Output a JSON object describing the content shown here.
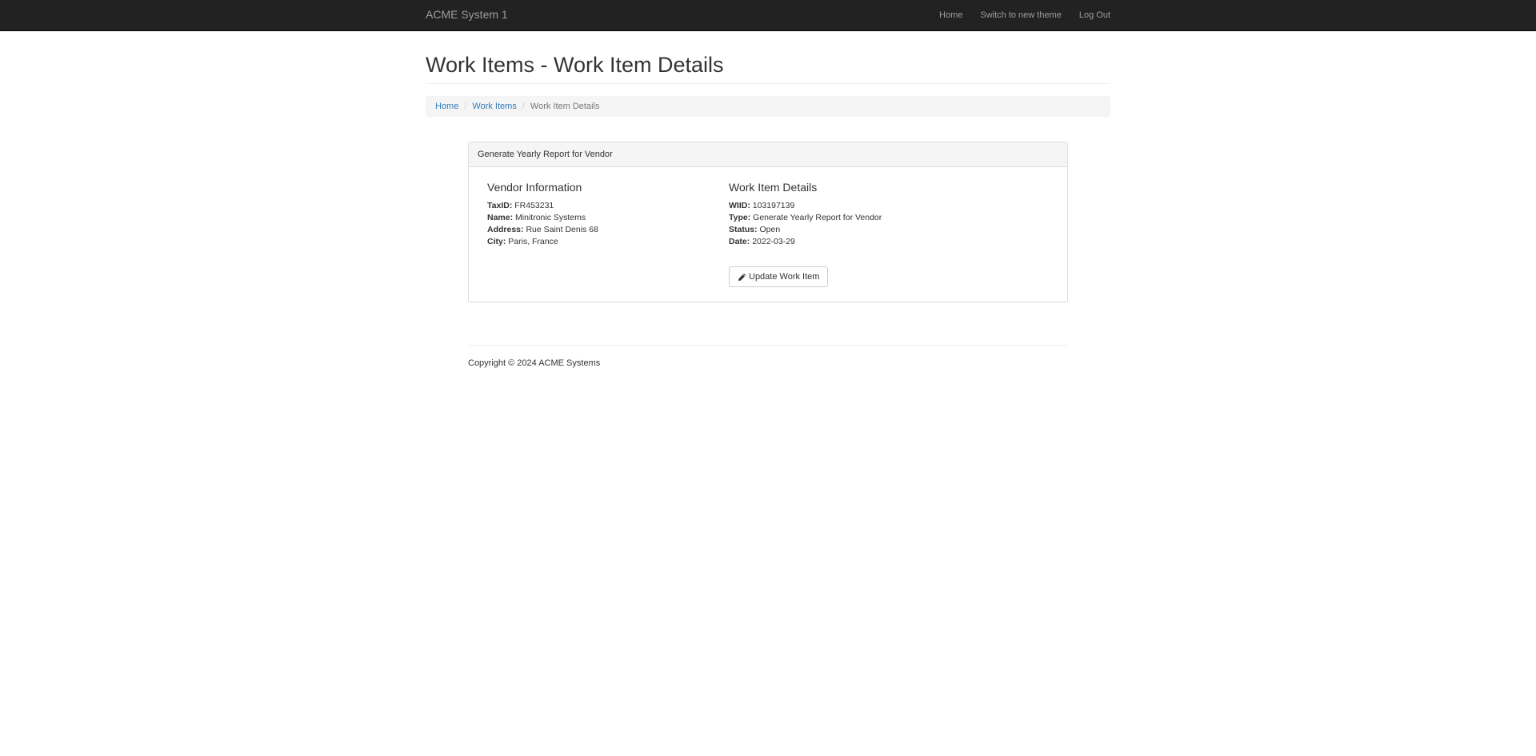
{
  "navbar": {
    "brand": "ACME System 1",
    "links": [
      "Home",
      "Switch to new theme",
      "Log Out"
    ]
  },
  "page": {
    "title": "Work Items - Work Item Details"
  },
  "breadcrumb": {
    "items": [
      "Home",
      "Work Items"
    ],
    "active": "Work Item Details",
    "separator": "/"
  },
  "panel": {
    "heading": "Generate Yearly Report for Vendor",
    "vendor": {
      "title": "Vendor Information",
      "fields": [
        {
          "label": "TaxID:",
          "value": "FR453231"
        },
        {
          "label": "Name:",
          "value": "Minitronic Systems"
        },
        {
          "label": "Address:",
          "value": "Rue Saint Denis 68"
        },
        {
          "label": "City:",
          "value": "Paris, France"
        }
      ]
    },
    "work_item": {
      "title": "Work Item Details",
      "fields": [
        {
          "label": "WIID:",
          "value": "103197139"
        },
        {
          "label": "Type:",
          "value": "Generate Yearly Report for Vendor"
        },
        {
          "label": "Status:",
          "value": "Open"
        },
        {
          "label": "Date:",
          "value": "2022-03-29"
        }
      ],
      "update_button": "Update Work Item",
      "update_icon": "pencil-icon"
    }
  },
  "footer": {
    "copyright": "Copyright © 2024 ACME Systems"
  },
  "colors": {
    "navbar_bg": "#222222",
    "link": "#337ab7",
    "panel_heading_bg": "#f5f5f5"
  }
}
